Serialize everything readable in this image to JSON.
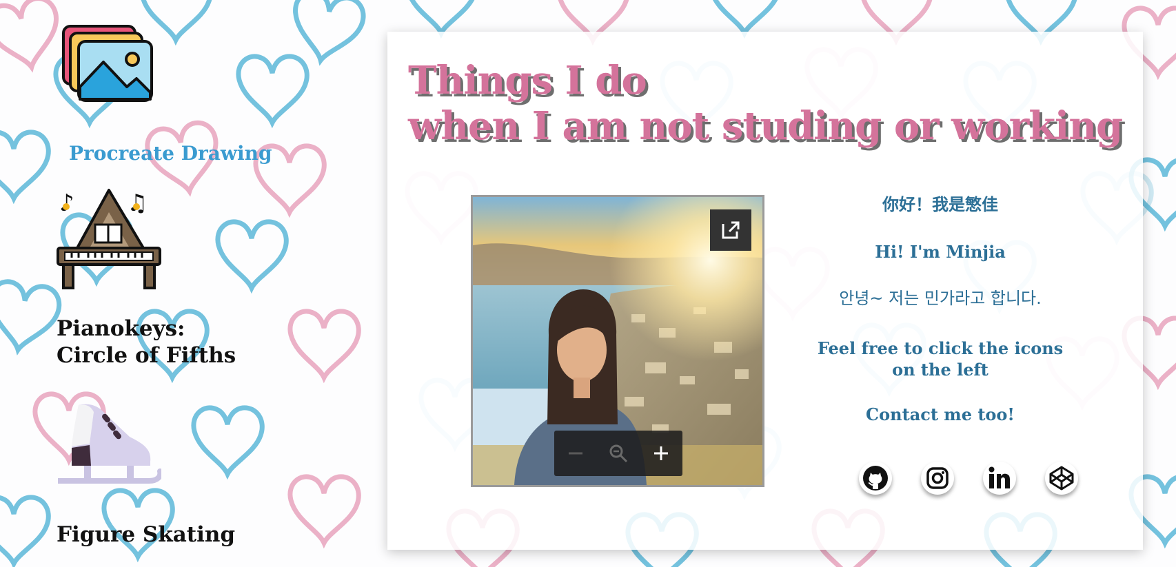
{
  "sidebar": {
    "items": [
      {
        "label": "Procreate Drawing",
        "icon": "gallery-images-icon"
      },
      {
        "label_line1": "Pianokeys:",
        "label_line2": "Circle of Fifths",
        "icon": "grand-piano-icon"
      },
      {
        "label": "Figure Skating",
        "icon": "ice-skate-icon"
      }
    ]
  },
  "main": {
    "title_line1": "Things I do",
    "title_line2": "when I am not studing or working",
    "viewer": {
      "open_icon": "open-external-icon",
      "zoom_out_icon": "minus-icon",
      "zoom_reset_icon": "magnifier-icon",
      "zoom_in_icon": "plus-icon"
    },
    "info": {
      "chinese": "你好！我是慜佳",
      "english": "Hi! I'm Minjia",
      "korean": "안녕~ 저는 민가라고 합니다.",
      "invite_line1": "Feel free to click the icons",
      "invite_line2": "on the left",
      "contact": "Contact me too!"
    },
    "social": [
      {
        "icon": "github-icon"
      },
      {
        "icon": "instagram-icon"
      },
      {
        "icon": "linkedin-icon"
      },
      {
        "icon": "codepen-icon"
      }
    ]
  },
  "colors": {
    "title_pink": "#d4739b",
    "title_shadow": "#6e6e6e",
    "info_blue": "#2c6f96",
    "procreate_blue": "#3a9bd0",
    "heart_blue": "#5bb8d8",
    "heart_pink": "#e8a3bd"
  }
}
